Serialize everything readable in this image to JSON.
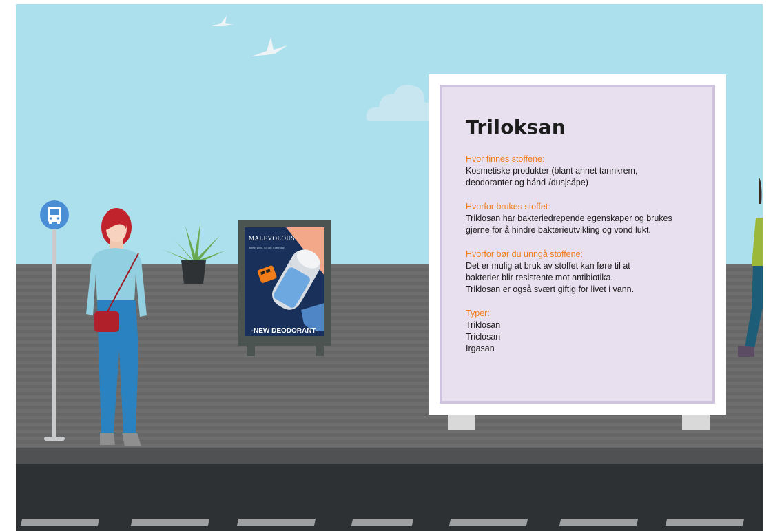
{
  "board": {
    "title": "Triloksan",
    "sections": [
      {
        "heading": "Hvor finnes stoffene:",
        "text": "Kosmetiske produkter (blant annet tannkrem,\ndeodoranter og hånd-/dusjsåpe)"
      },
      {
        "heading": "Hvorfor brukes stoffet:",
        "text": "Triklosan har bakteriedrepende egenskaper og brukes\ngjerne for å hindre bakterieutvikling og vond lukt."
      },
      {
        "heading": "Hvorfor bør du unngå stoffene:",
        "text": "Det er mulig at bruk av stoffet kan føre til at\nbakterier blir resistente mot antibiotika.\nTriklosan er også svært giftig for livet i vann."
      },
      {
        "heading": "Typer:",
        "text": "Triklosan\nTriclosan\nIrgasan"
      }
    ]
  },
  "poster": {
    "brand": "MALEVOLOUS",
    "tagline": "Smells good. All day. Every day.",
    "cta": "-NEW DEODORANT-"
  },
  "colors": {
    "sky": "#ade0ed",
    "sidewalk": "#6e6e6e",
    "road": "#2d3133",
    "board_bg": "#e8e0ee",
    "accent_heading": "#f07d1a",
    "poster_bg": "#18305a"
  },
  "icons": {
    "bus_stop": "bus-icon"
  }
}
